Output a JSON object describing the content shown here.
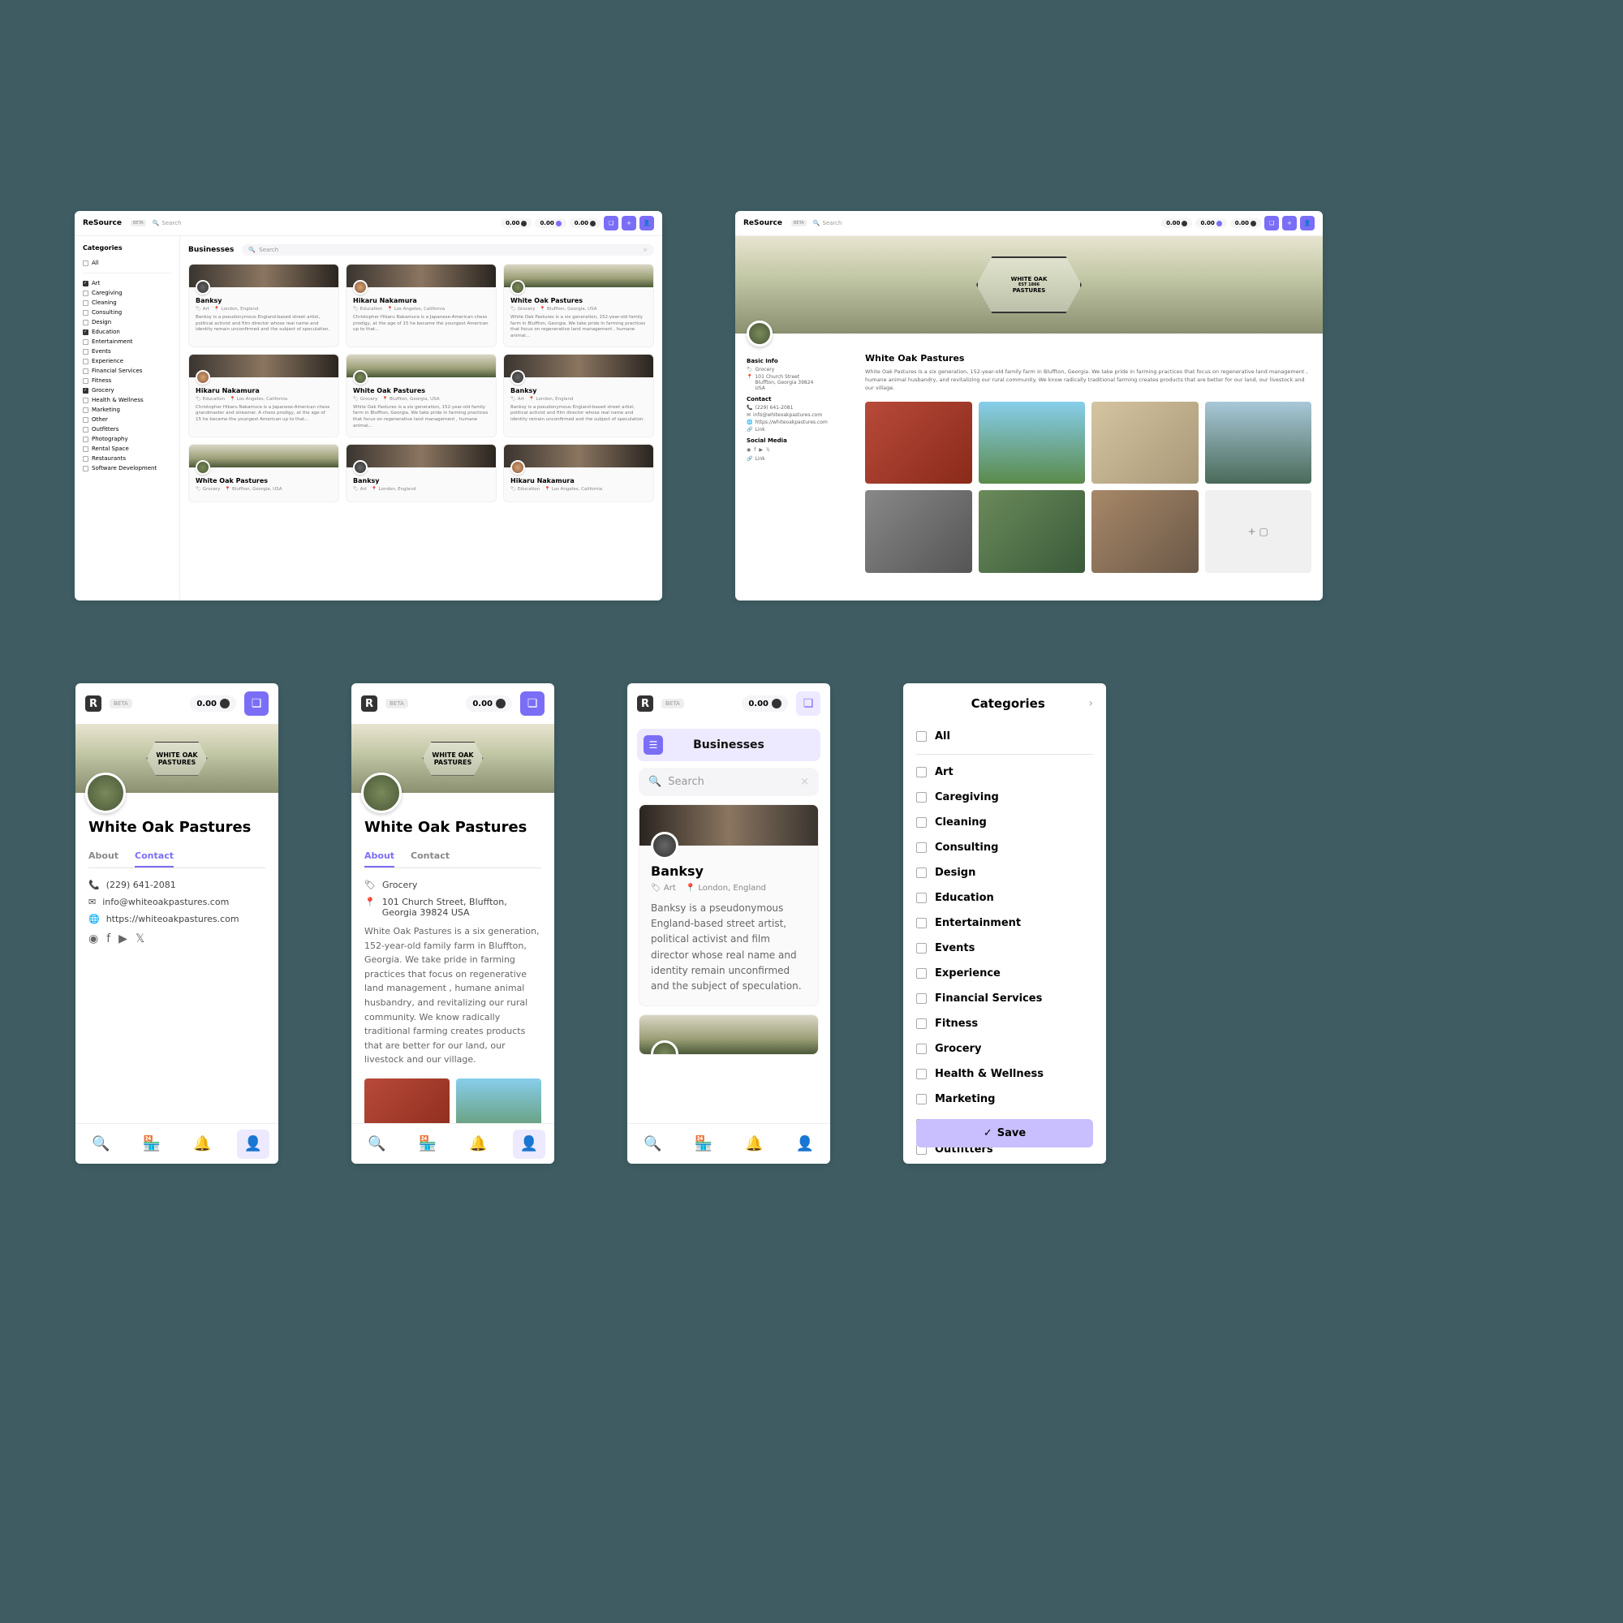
{
  "brand": "ReSource",
  "beta": "BETA",
  "search_label": "Search",
  "balances": [
    {
      "val": "0.00"
    },
    {
      "val": "0.00"
    },
    {
      "val": "0.00"
    }
  ],
  "categories": {
    "title": "Categories",
    "all": "All",
    "items": [
      {
        "label": "Art",
        "checked": true
      },
      {
        "label": "Caregiving",
        "checked": false
      },
      {
        "label": "Cleaning",
        "checked": false
      },
      {
        "label": "Consulting",
        "checked": false
      },
      {
        "label": "Design",
        "checked": false
      },
      {
        "label": "Education",
        "checked": true
      },
      {
        "label": "Entertainment",
        "checked": false
      },
      {
        "label": "Events",
        "checked": false
      },
      {
        "label": "Experience",
        "checked": false
      },
      {
        "label": "Financial Services",
        "checked": false
      },
      {
        "label": "Fitness",
        "checked": false
      },
      {
        "label": "Grocery",
        "checked": true
      },
      {
        "label": "Health & Wellness",
        "checked": false
      },
      {
        "label": "Marketing",
        "checked": false
      },
      {
        "label": "Other",
        "checked": false
      },
      {
        "label": "Outfitters",
        "checked": false
      },
      {
        "label": "Photography",
        "checked": false
      },
      {
        "label": "Rental Space",
        "checked": false
      },
      {
        "label": "Restaurants",
        "checked": false
      },
      {
        "label": "Software Development",
        "checked": false
      }
    ]
  },
  "listing": {
    "title": "Businesses",
    "cards": [
      {
        "name": "Banksy",
        "tag": "Art",
        "loc": "London, England",
        "desc": "Banksy is a pseudonymous England-based street artist, political activist and film director whose real name and identity remain unconfirmed and the subject of speculation.",
        "av": "bk",
        "bg": "hn"
      },
      {
        "name": "Hikaru Nakamura",
        "tag": "Education",
        "loc": "Los Angeles, California",
        "desc": "Christopher Hikaru Nakamura is a Japanese-American chess prodigy, at the age of 15 he became the youngest American up to that...",
        "av": "hn",
        "bg": "hn"
      },
      {
        "name": "White Oak Pastures",
        "tag": "Grocery",
        "loc": "Bluffton, Georgia, USA",
        "desc": "White Oak Pastures is a six generation, 152-year-old family farm in Bluffton, Georgia. We take pride in farming practices that focus on regenerative land management , humane animal...",
        "av": "",
        "bg": "wop"
      },
      {
        "name": "Hikaru Nakamura",
        "tag": "Education",
        "loc": "Los Angeles, California",
        "desc": "Christopher Hikaru Nakamura is a Japanese-American chess grandmaster and streamer. A chess prodigy, at the age of 15 he became the youngest American up to that...",
        "av": "hn",
        "bg": "hn"
      },
      {
        "name": "White Oak Pastures",
        "tag": "Grocery",
        "loc": "Bluffton, Georgia, USA",
        "desc": "White Oak Pastures is a six generation, 152-year-old family farm in Bluffton, Georgia. We take pride in farming practices that focus on regenerative land management , humane animal...",
        "av": "",
        "bg": "wop"
      },
      {
        "name": "Banksy",
        "tag": "Art",
        "loc": "London, England",
        "desc": "Banksy is a pseudonymous England-based street artist, political activist and film director whose real name and identity remain unconfirmed and the subject of speculation.",
        "av": "bk",
        "bg": "hn"
      },
      {
        "name": "White Oak Pastures",
        "tag": "Grocery",
        "loc": "Bluffton, Georgia, USA",
        "desc": "",
        "av": "",
        "bg": "wop"
      },
      {
        "name": "Banksy",
        "tag": "Art",
        "loc": "London, England",
        "desc": "",
        "av": "bk",
        "bg": "hn"
      },
      {
        "name": "Hikaru Nakamura",
        "tag": "Education",
        "loc": "Los Angeles, California",
        "desc": "",
        "av": "hn",
        "bg": "hn"
      }
    ]
  },
  "detail": {
    "title": "White Oak Pastures",
    "logo1": "WHITE OAK",
    "logo2": "PASTURES",
    "logo_sub": "EST 1866",
    "basic_info": "Basic Info",
    "category": "Grocery",
    "address1": "101 Church Street",
    "address2": "Bluffton, Georgia 39824",
    "address3": "USA",
    "contact_h": "Contact",
    "phone": "(229) 641-2081",
    "email": "info@whiteoakpastures.com",
    "url": "https://whiteoakpastures.com",
    "link": "Link",
    "social_h": "Social Media",
    "about": "White Oak Pastures is a six generation, 152-year-old family farm in Bluffton, Georgia. We take pride in farming practices that focus on regenerative land management , humane animal husbandry, and revitalizing our rural community. We know radically traditional farming creates products that are better for our land, our livestock and our village."
  },
  "mobile": {
    "balance": "0.00",
    "tab_about": "About",
    "tab_contact": "Contact",
    "address_full": "101 Church Street, Bluffton, Georgia 39824 USA"
  },
  "m3": {
    "title": "Businesses",
    "card": {
      "name": "Banksy",
      "tag": "Art",
      "loc": "London, England",
      "desc": "Banksy is a pseudonymous England-based street artist, political activist and film director whose real name and identity remain unconfirmed and the subject of speculation."
    }
  },
  "m4": {
    "title": "Categories",
    "save": "Save"
  }
}
